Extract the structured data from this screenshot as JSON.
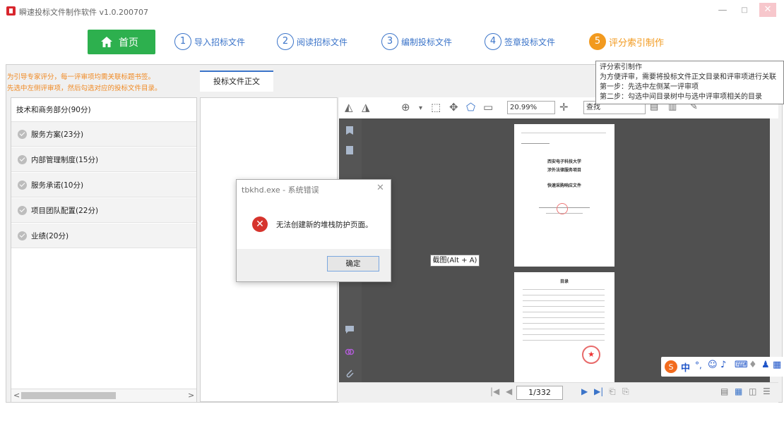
{
  "window": {
    "title": "瞬速投标文件制作软件 v1.0.200707",
    "minimize": "—",
    "maximize": "□",
    "close": "✕"
  },
  "nav": {
    "home_label": "首页",
    "steps": [
      {
        "num": "1",
        "label": "导入招标文件"
      },
      {
        "num": "2",
        "label": "阅读招标文件"
      },
      {
        "num": "3",
        "label": "编制投标文件"
      },
      {
        "num": "4",
        "label": "签章投标文件"
      },
      {
        "num": "5",
        "label": "评分索引制作"
      }
    ]
  },
  "tooltip": {
    "lines": [
      "评分索引制作",
      "为方便评审，需要将投标文件正文目录和评审项进行关联",
      "第一步：先选中左侧某一评审项",
      "第二步：勾选中间目录树中与选中评审项相关的目录"
    ]
  },
  "hint": {
    "line1": "为引导专家评分，每一评审项均需关联标题书签。",
    "line2": "先选中左侧评审项，然后勾选对应的投标文件目录。"
  },
  "tab": {
    "label": "投标文件正文"
  },
  "scoring": {
    "header": "技术和商务部分(90分)",
    "items": [
      {
        "label": "服务方案(23分)"
      },
      {
        "label": "内部管理制度(15分)"
      },
      {
        "label": "服务承诺(10分)"
      },
      {
        "label": "项目团队配置(22分)"
      },
      {
        "label": "业绩(20分)"
      }
    ]
  },
  "pdf": {
    "zoom": "20.99%",
    "find_placeholder": "查找",
    "page_indicator": "1/332",
    "page1": {
      "line1": "西安电子科技大学",
      "line2": "涉外法律服务项目",
      "line3": "快速采购响应文件"
    },
    "page2": {
      "heading": "目录"
    },
    "seal_glyph": "★"
  },
  "screenshot_tip": "截图(Alt + A)",
  "dialog": {
    "title": "tbkhd.exe - 系统错误",
    "close": "✕",
    "message": "无法创建新的堆栈防护页面。",
    "ok_label": "确定",
    "icon_glyph": "✕"
  },
  "ime": {
    "label": "中"
  },
  "colors": {
    "accent_blue": "#3b74c9",
    "home_green": "#2db04e",
    "active_orange": "#f29a1f",
    "hint_orange": "#f08a24",
    "error_red": "#d6342d"
  }
}
